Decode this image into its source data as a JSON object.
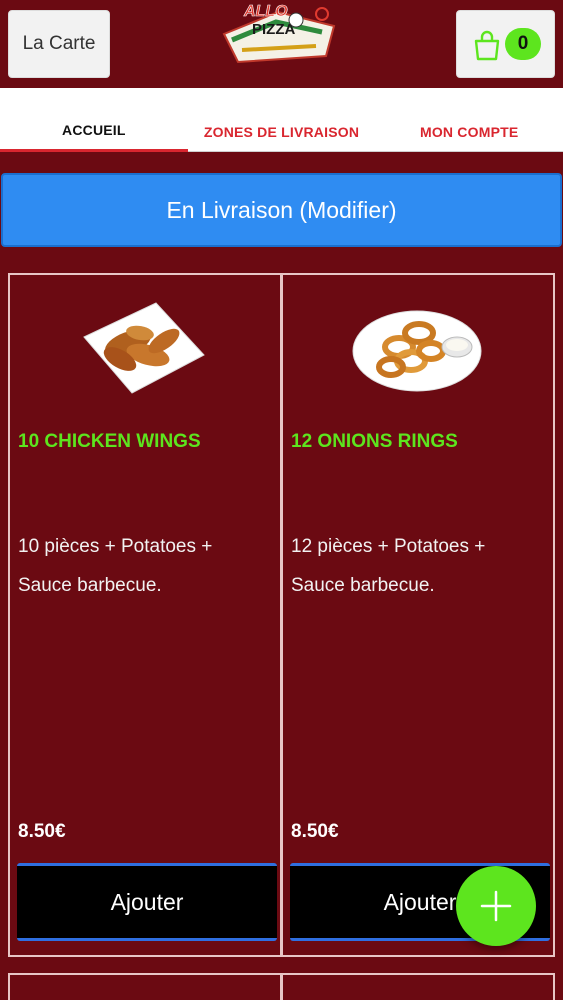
{
  "header": {
    "menu_label": "La Carte",
    "logo_text": "ALLO PIZZA",
    "cart_count": "0"
  },
  "tabs": [
    {
      "label": "ACCUEIL",
      "active": true
    },
    {
      "label": "ZONES DE LIVRAISON",
      "active": false
    },
    {
      "label": "MON COMPTE",
      "active": false
    }
  ],
  "delivery": {
    "label": "En Livraison (Modifier)"
  },
  "products": [
    {
      "name": "10 CHICKEN WINGS",
      "desc_line1": "10 pièces  + Potatoes  +",
      "desc_line2": "Sauce barbecue.",
      "price": "8.50€",
      "button": "Ajouter"
    },
    {
      "name": "12 ONIONS RINGS",
      "desc_line1": "12 pièces  + Potatoes  +",
      "desc_line2": "Sauce barbecue.",
      "price": "8.50€",
      "button": "Ajouter"
    }
  ],
  "colors": {
    "background": "#6b0a12",
    "accent_green": "#5de51e",
    "accent_blue": "#2f8cf2",
    "tab_red": "#d9262f"
  },
  "icons": [
    "shopping-bag-icon",
    "plus-icon"
  ]
}
